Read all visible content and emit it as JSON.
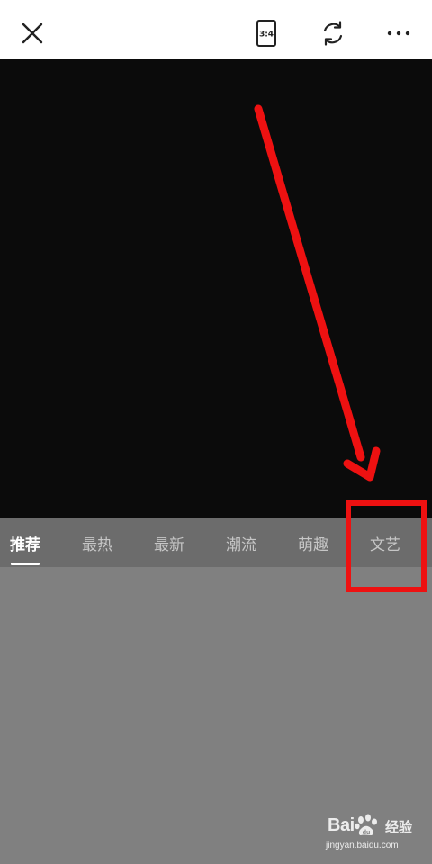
{
  "toolbar": {
    "close_icon": "close-icon",
    "ratio_label": "3:4",
    "rotate_icon": "rotate-icon",
    "more_icon": "more-icon"
  },
  "tabs": [
    {
      "label": "推荐",
      "active": true
    },
    {
      "label": "最热",
      "active": false
    },
    {
      "label": "最新",
      "active": false
    },
    {
      "label": "潮流",
      "active": false
    },
    {
      "label": "萌趣",
      "active": false
    },
    {
      "label": "文艺",
      "active": false
    }
  ],
  "annotation": {
    "color": "#ee1111",
    "target_tab": "文艺"
  },
  "watermark": {
    "brand_left": "Bai",
    "brand_right": "经验",
    "url": "jingyan.baidu.com"
  },
  "colors": {
    "topbar_bg": "#ffffff",
    "preview_bg": "#0b0b0b",
    "tabs_bg": "#6c6c6c",
    "content_bg": "#808080",
    "tab_active": "#ffffff",
    "tab_inactive": "#c6c6c6"
  }
}
